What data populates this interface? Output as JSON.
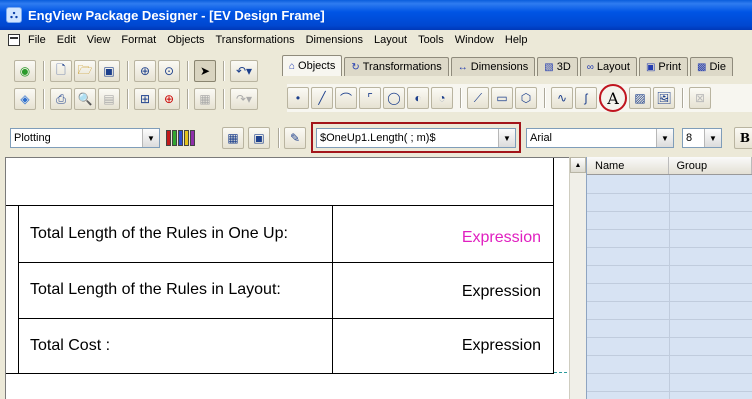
{
  "window": {
    "title": "EngView Package Designer - [EV Design Frame]",
    "app_icon": "engview-logo-icon"
  },
  "menu": [
    "File",
    "Edit",
    "View",
    "Format",
    "Objects",
    "Transformations",
    "Dimensions",
    "Layout",
    "Tools",
    "Window",
    "Help"
  ],
  "tabs": [
    {
      "label": "Objects",
      "icon": "objects-tab-icon",
      "active": true
    },
    {
      "label": "Transformations",
      "icon": "transformations-tab-icon",
      "active": false
    },
    {
      "label": "Dimensions",
      "icon": "dimensions-tab-icon",
      "active": false
    },
    {
      "label": "3D",
      "icon": "3d-tab-icon",
      "active": false
    },
    {
      "label": "Layout",
      "icon": "layout-tab-icon",
      "active": false
    },
    {
      "label": "Print",
      "icon": "print-tab-icon",
      "active": false
    },
    {
      "label": "Die",
      "icon": "die-tab-icon",
      "active": false
    }
  ],
  "format": {
    "layer": "Plotting",
    "expression": "$OneUp1.Length( ; m)$",
    "font": "Arial",
    "size": "8",
    "bold_label": "B"
  },
  "table": {
    "rows": [
      {
        "label": "Total Length of the Rules in One Up:",
        "value": "Expression",
        "value_color": "#e020c0"
      },
      {
        "label": "Total Length of the Rules in Layout:",
        "value": "Expression",
        "value_color": "#000000"
      },
      {
        "label": "Total Cost :",
        "value": "Expression",
        "value_color": "#000000"
      }
    ]
  },
  "panel": {
    "columns": [
      "Name",
      "Group"
    ]
  },
  "colors": {
    "title_bar": "#0055e5",
    "highlight_red": "#c0141e",
    "magenta_expression": "#e020c0"
  }
}
